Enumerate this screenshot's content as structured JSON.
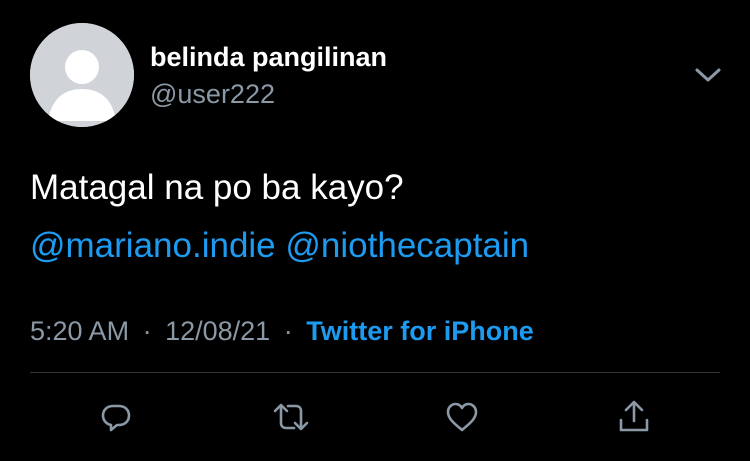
{
  "tweet": {
    "author": {
      "display_name": "belinda pangilinan",
      "handle": "@user222",
      "avatar_icon": "default-avatar-icon"
    },
    "text": "Matagal na po ba kayo?",
    "mentions": [
      "@mariano.indie",
      "@niothecaptain"
    ],
    "meta": {
      "time": "5:20 AM",
      "separator": "·",
      "date": "12/08/21",
      "source": "Twitter for iPhone"
    },
    "actions": {
      "reply_icon": "reply-icon",
      "retweet_icon": "retweet-icon",
      "like_icon": "heart-icon",
      "share_icon": "share-icon"
    },
    "menu_icon": "chevron-down-icon"
  },
  "colors": {
    "background": "#000000",
    "text_primary": "#ffffff",
    "text_secondary": "#8b98a5",
    "link": "#1d9bf0",
    "divider": "#2f3336",
    "icon": "#8b98a5"
  }
}
